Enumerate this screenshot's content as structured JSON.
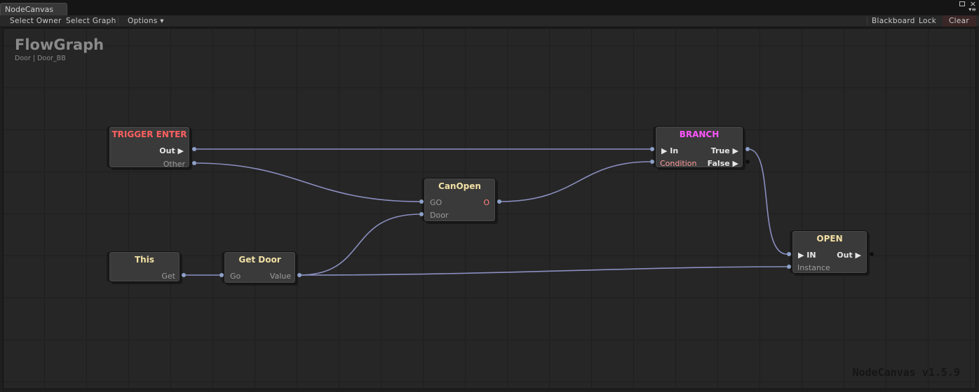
{
  "window": {
    "tab_title": "NodeCanvas",
    "close_glyph": "×",
    "menu_glyph": "▾≡"
  },
  "toolbar": {
    "select_owner": "Select Owner",
    "select_graph": "Select Graph",
    "options": "Options ▾",
    "blackboard": "Blackboard",
    "lock": "Lock",
    "clear": "Clear"
  },
  "graph": {
    "title": "FlowGraph",
    "subtitle": "Door | Door_BB",
    "watermark": "NodeCanvas v1.5.9"
  },
  "nodes": {
    "trigger_enter": {
      "title": "TRIGGER ENTER",
      "title_color": "#ff6060",
      "out": "Out ▶",
      "other": "Other"
    },
    "branch": {
      "title": "BRANCH",
      "title_color": "#ff55ff",
      "in": "▶ In",
      "condition": "Condition",
      "condition_color": "#ff9a9a",
      "true": "True ▶",
      "false": "False ▶"
    },
    "can_open": {
      "title": "CanOpen",
      "go": "GO",
      "door": "Door",
      "out": "O",
      "out_color": "#ff8080"
    },
    "this": {
      "title": "This",
      "get": "Get"
    },
    "get_door": {
      "title": "Get Door",
      "go": "Go",
      "value": "Value"
    },
    "open": {
      "title": "OPEN",
      "in": "▶ IN",
      "out": "Out ▶",
      "instance": "Instance"
    }
  },
  "colors": {
    "wire": "#8a8fc0",
    "port": "#8ea0c8",
    "node_title": "#f2e0a4"
  }
}
